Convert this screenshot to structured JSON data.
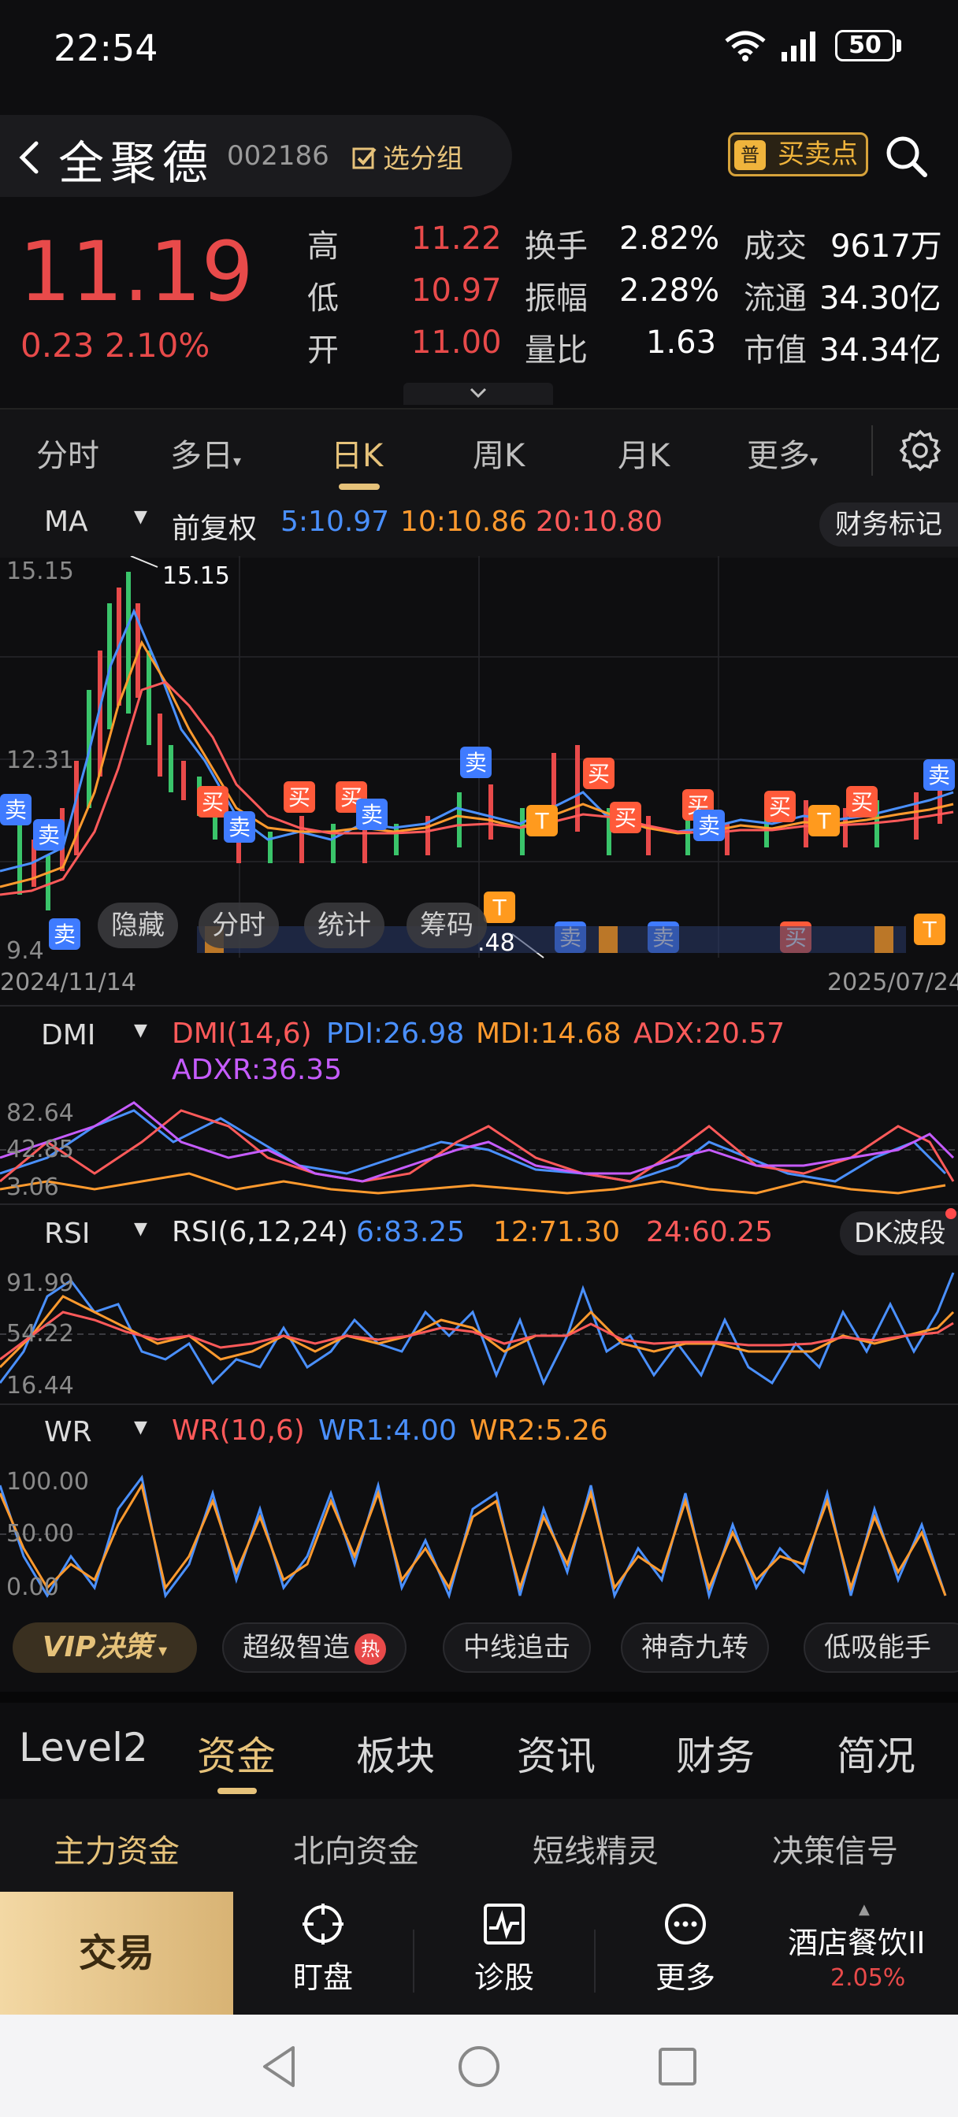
{
  "status": {
    "time": "22:54",
    "battery": "50"
  },
  "header": {
    "name": "全聚德",
    "code": "002186",
    "group_label": "选分组",
    "buy_sell_badge": "普",
    "buy_sell_label": "买卖点"
  },
  "quote": {
    "price": "11.19",
    "change": "0.23 2.10%",
    "rows": [
      {
        "l1": "高",
        "v1": "11.22",
        "l2": "换手",
        "v2": "2.82%",
        "l3": "成交",
        "v3": "9617万"
      },
      {
        "l1": "低",
        "v1": "10.97",
        "l2": "振幅",
        "v2": "2.28%",
        "l3": "流通",
        "v3": "34.30亿"
      },
      {
        "l1": "开",
        "v1": "11.00",
        "l2": "量比",
        "v2": "1.63",
        "l3": "市值",
        "v3": "34.34亿"
      }
    ]
  },
  "ktabs": [
    "分时",
    "多日",
    "日K",
    "周K",
    "月K",
    "更多"
  ],
  "ma": {
    "selector": "MA",
    "adjust": "前复权",
    "ma5": "5:10.97",
    "ma10": "10:10.86",
    "ma20": "20:10.80",
    "fin_label": "财务标记",
    "y_top": "15.15",
    "y_mid": "12.31",
    "y_bot": "9.4",
    "high_mark": "15.15",
    "low_mark": ".48",
    "date_start": "2024/11/14",
    "date_end": "2025/07/24",
    "overlay": [
      "隐藏",
      "分时",
      "统计",
      "筹码"
    ],
    "signal_buy": "买",
    "signal_sell": "卖",
    "signal_t": "T"
  },
  "dmi": {
    "selector": "DMI",
    "title": "DMI(14,6)",
    "pdi": "PDI:26.98",
    "mdi": "MDI:14.68",
    "adx": "ADX:20.57",
    "adxr": "ADXR:36.35",
    "y_top": "82.64",
    "y_mid": "42.85",
    "y_bot": "3.06"
  },
  "rsi": {
    "selector": "RSI",
    "title": "RSI(6,12,24)",
    "r6": "6:83.25",
    "r12": "12:71.30",
    "r24": "24:60.25",
    "dk_label": "DK波段",
    "y_top": "91.99",
    "y_mid": "54.22",
    "y_bot": "16.44"
  },
  "wr": {
    "selector": "WR",
    "title": "WR(10,6)",
    "wr1": "WR1:4.00",
    "wr2": "WR2:5.26",
    "y_top": "100.00",
    "y_mid": "50.00",
    "y_bot": "0.00"
  },
  "vip": {
    "label": "VIP决策",
    "hot": "热",
    "chips": [
      "超级智造",
      "中线追击",
      "神奇九转",
      "低吸能手"
    ]
  },
  "sections": [
    "Level2",
    "资金",
    "板块",
    "资讯",
    "财务",
    "简况"
  ],
  "subtabs": [
    "主力资金",
    "北向资金",
    "短线精灵",
    "决策信号"
  ],
  "bottom": {
    "trade": "交易",
    "items": [
      "盯盘",
      "诊股",
      "更多"
    ],
    "sector": "酒店餐饮II",
    "sector_pct": "2.05%"
  },
  "colors": {
    "up": "#e84a4a",
    "gold": "#e6c27a",
    "ma5": "#4a90ff",
    "ma10": "#ff9a2e",
    "ma20": "#ff5a5a",
    "adxr": "#c65cff"
  }
}
